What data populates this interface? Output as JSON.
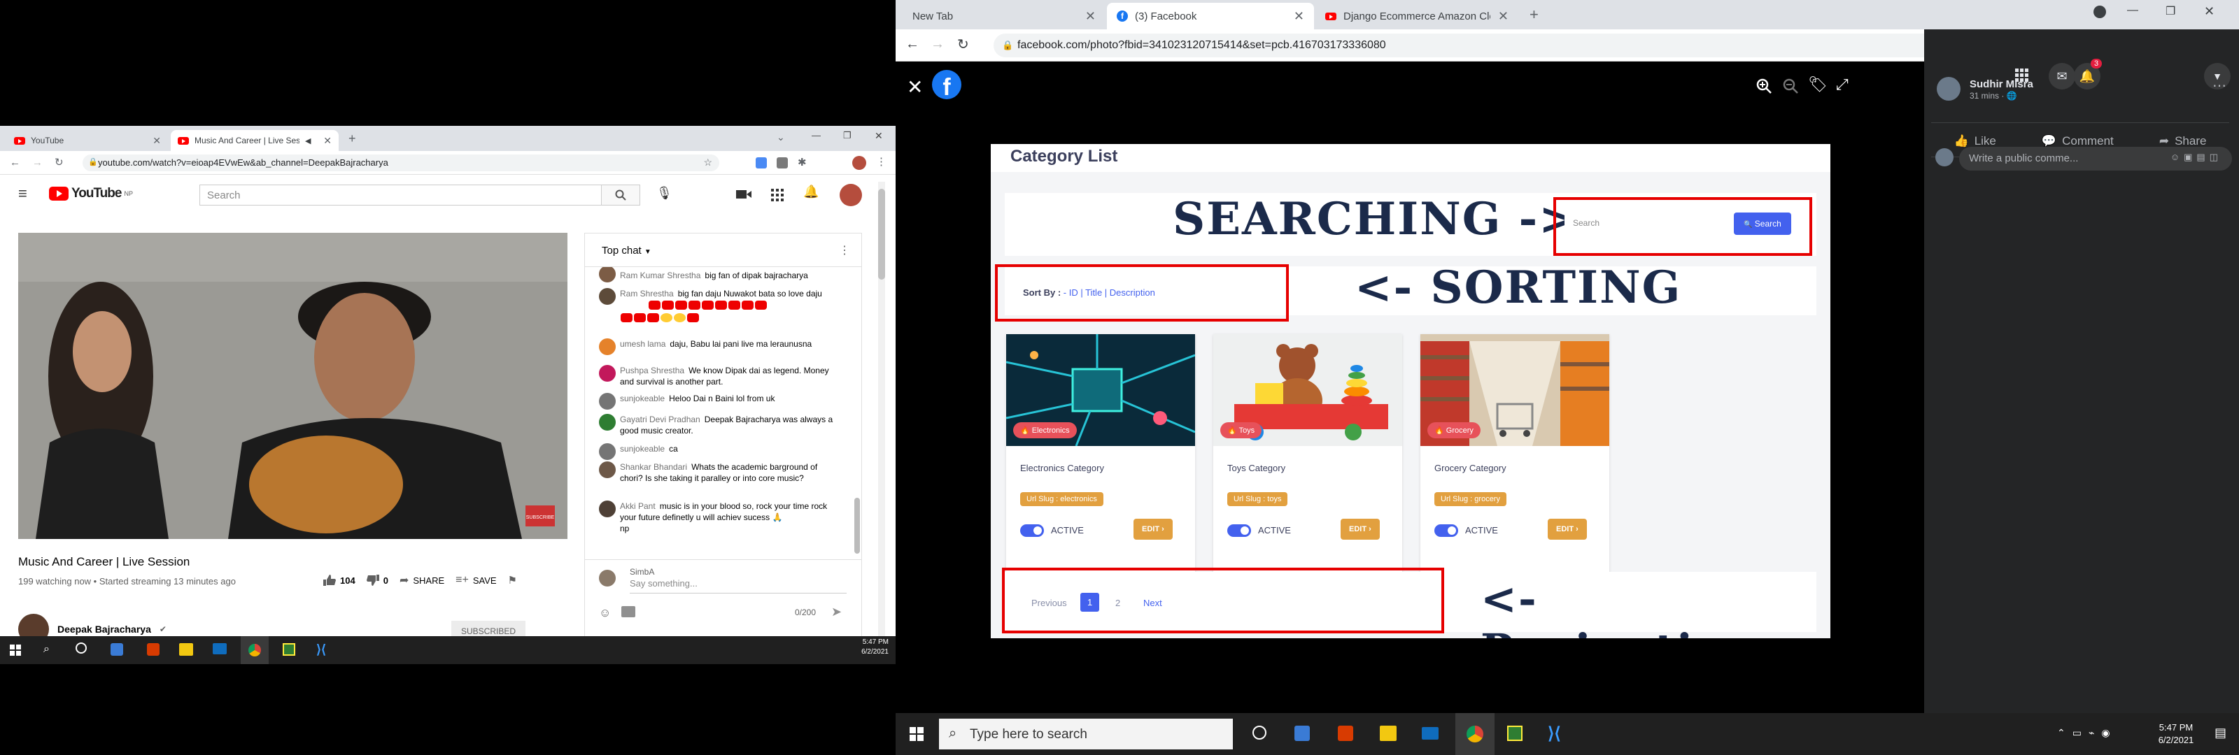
{
  "left": {
    "tabs": [
      {
        "label": "YouTube"
      },
      {
        "label": "Music And Career | Live Sess"
      }
    ],
    "url": "youtube.com/watch?v=eioap4EVwEw&ab_channel=DeepakBajracharya",
    "youtube": {
      "logo": "YouTube",
      "logo_region": "NP",
      "search_placeholder": "Search",
      "video_title": "Music And Career | Live Session",
      "video_meta": "199 watching now • Started streaming 13 minutes ago",
      "likes": "104",
      "dislikes": "0",
      "share_label": "SHARE",
      "save_label": "SAVE",
      "channel_name": "Deepak Bajracharya",
      "subscribe_label": "SUBSCRIBED",
      "video_watermark": "SUBSCRIBE"
    },
    "chat": {
      "header": "Top chat",
      "messages": [
        {
          "author": "Ram Kumar Shrestha",
          "text": "big fan of dipak bajracharya"
        },
        {
          "author": "Ram Shrestha",
          "text": "big fan daju Nuwakot bata so love daju"
        },
        {
          "author": "umesh lama",
          "text": "daju, Babu lai pani live ma leraunusna"
        },
        {
          "author": "Pushpa Shrestha",
          "text": "We know Dipak dai as legend. Money and survival is another part."
        },
        {
          "author": "sunjokeable",
          "text": "Heloo Dai n Baini lol from uk"
        },
        {
          "author": "Gayatri Devi Pradhan",
          "text": "Deepak Bajracharya was always a good music creator."
        },
        {
          "author": "sunjokeable",
          "text": "ca"
        },
        {
          "author": "Shankar Bhandari",
          "text": "Whats the academic barground of chori? Is she taking it paralley or into core music?"
        },
        {
          "author": "Akki Pant",
          "text": "music is in your blood so, rock your time rock your future definetly u will achiev sucess"
        }
      ],
      "msg_tail": "np",
      "input_user": "SimbA",
      "input_placeholder": "Say something...",
      "char_count": "0/200"
    },
    "taskbar": {
      "time": "5:47 PM",
      "date": "6/2/2021"
    }
  },
  "right": {
    "tabs": [
      {
        "label": "New Tab"
      },
      {
        "label": "(3) Facebook"
      },
      {
        "label": "Django Ecommerce Amazon Clo"
      }
    ],
    "url": "facebook.com/photo?fbid=341023120715414&set=pcb.416703173336080",
    "facebook": {
      "notif_count": "3",
      "poster_name": "Sudhir Misra",
      "post_time": "31 mins · ",
      "like_label": "Like",
      "comment_label": "Comment",
      "share_label": "Share",
      "comment_placeholder": "Write a public comme..."
    },
    "photo": {
      "title": "Category List",
      "searching_label": "SEARCHING ->",
      "search_placeholder": "Search",
      "search_button": "Search",
      "sort_label": "Sort By :",
      "sort_options": "- ID | Title | Description",
      "sorting_label": "<- SORTING",
      "cards": [
        {
          "tag": "Electronics",
          "title": "Electronics Category",
          "slug": "Url Slug : electronics",
          "status": "ACTIVE",
          "edit": "EDIT"
        },
        {
          "tag": "Toys",
          "title": "Toys Category",
          "slug": "Url Slug : toys",
          "status": "ACTIVE",
          "edit": "EDIT"
        },
        {
          "tag": "Grocery",
          "title": "Grocery Category",
          "slug": "Url Slug : grocery",
          "status": "ACTIVE",
          "edit": "EDIT"
        }
      ],
      "pagination": {
        "previous": "Previous",
        "pages": [
          "1",
          "2"
        ],
        "next": "Next"
      },
      "pagination_label": "<- Pagination"
    },
    "taskbar": {
      "search_placeholder": "Type here to search",
      "time": "5:47 PM",
      "date": "6/2/2021"
    }
  },
  "colors": {
    "red_box": "#e60000",
    "primary": "#4361ee",
    "warning": "#e2a03f",
    "fb_blue": "#1877f2"
  }
}
